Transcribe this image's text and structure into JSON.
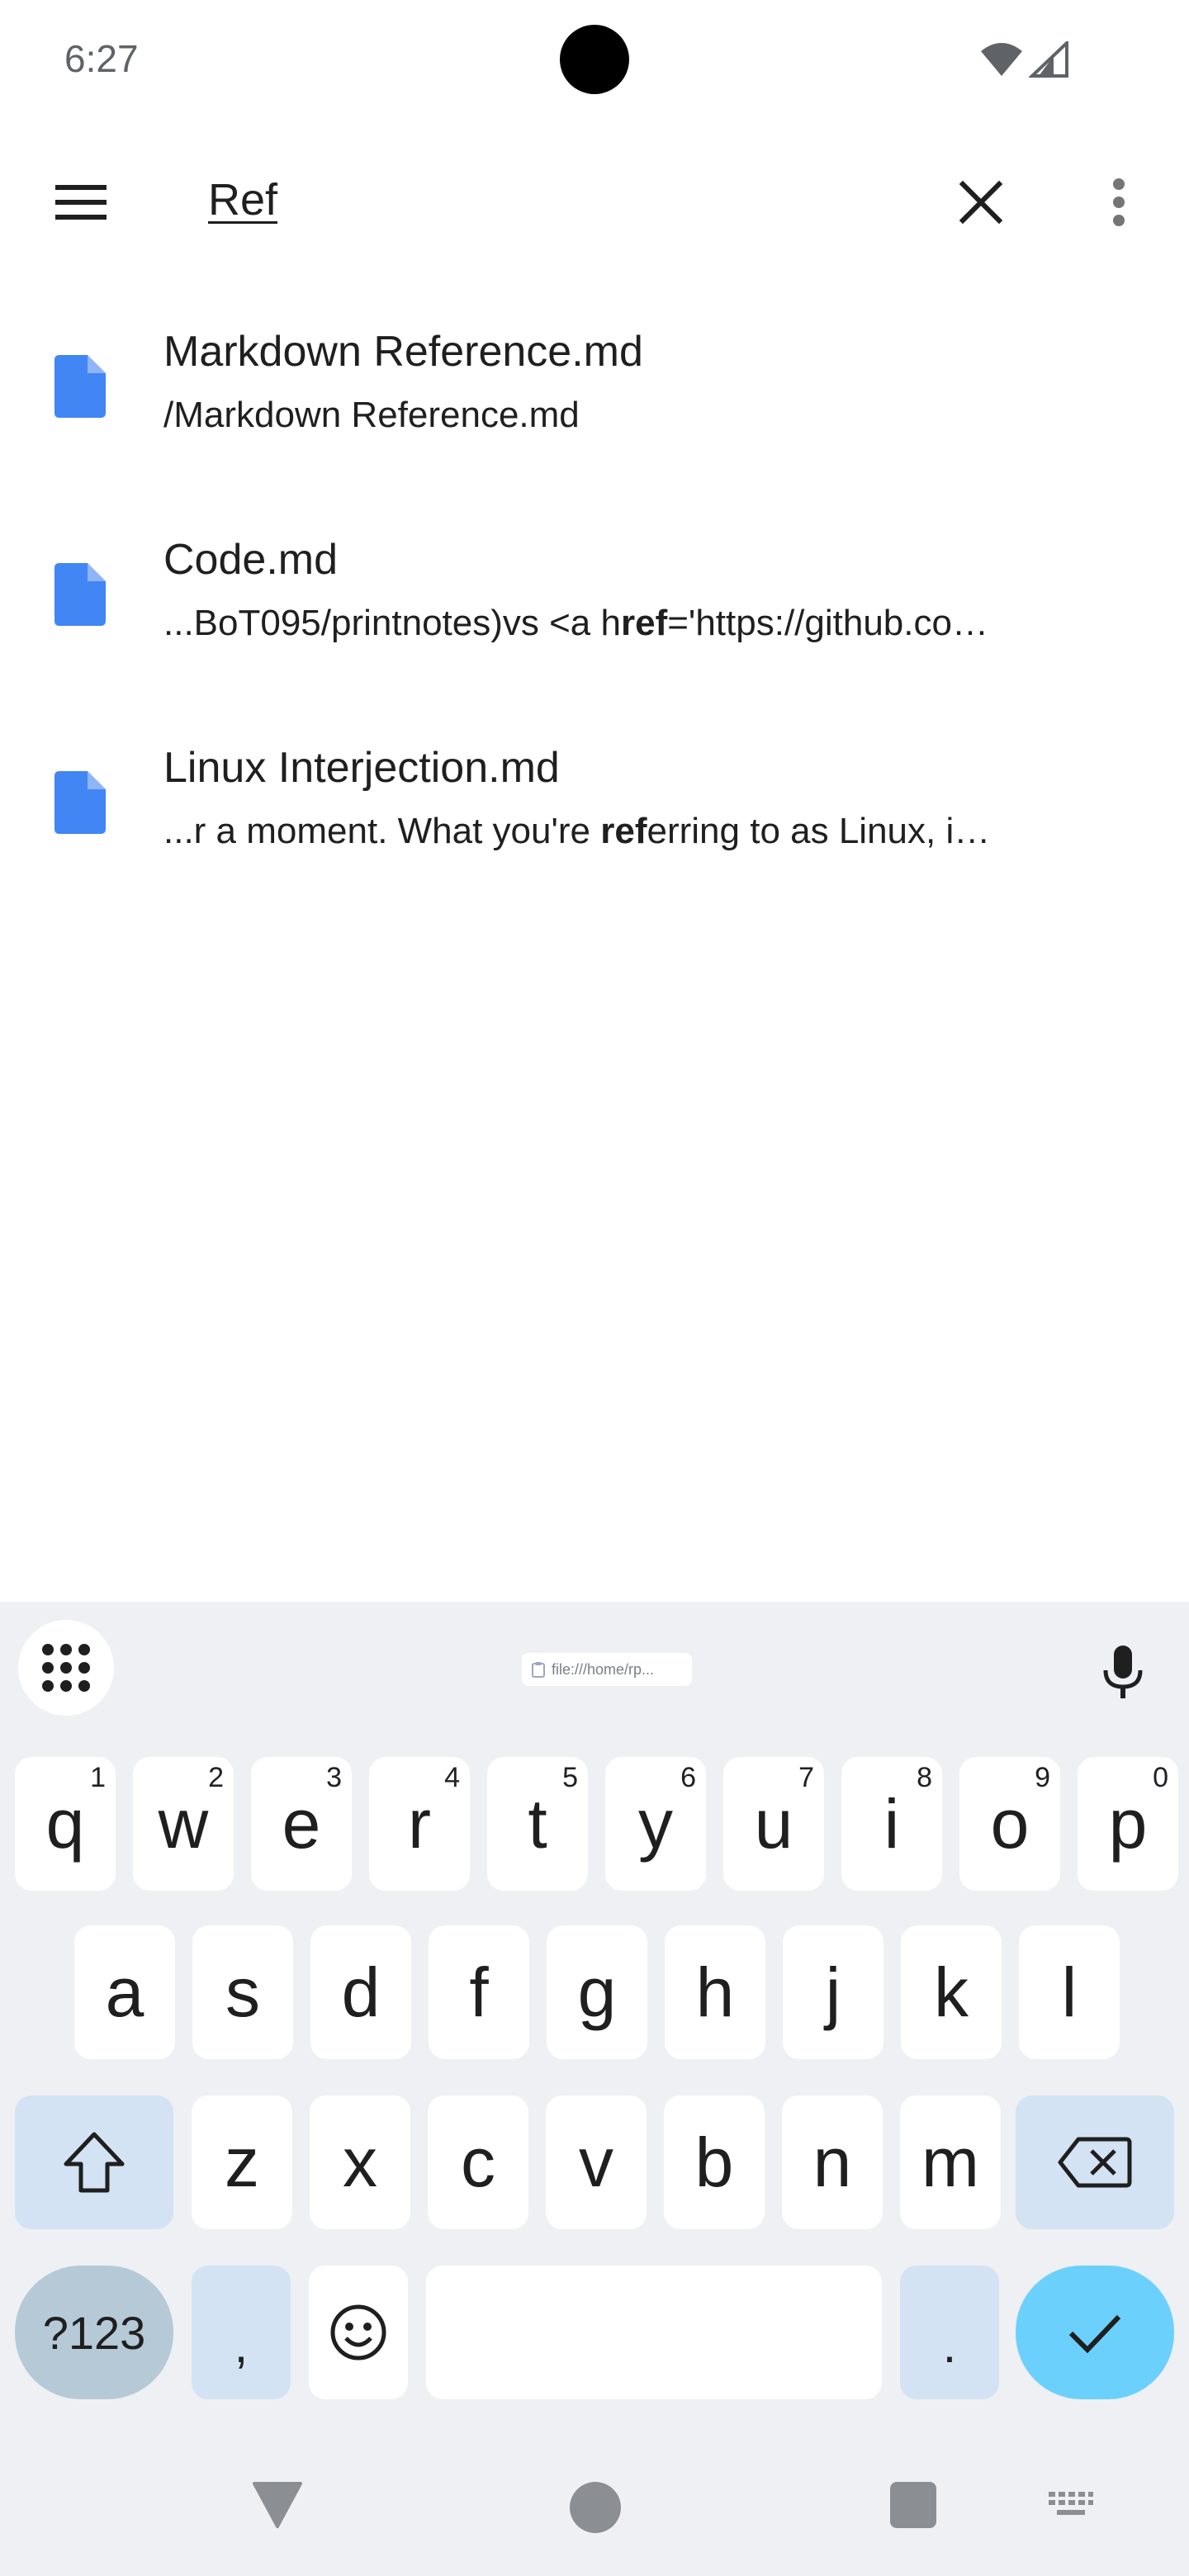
{
  "status_bar": {
    "time": "6:27",
    "icons": [
      "wifi-icon",
      "signal-icon"
    ]
  },
  "app_bar": {
    "menu_icon": "hamburger-menu-icon",
    "search_value": "Ref",
    "clear_icon": "close-icon",
    "more_icon": "more-vert-icon"
  },
  "results": [
    {
      "icon": "file-icon",
      "title": "Markdown Reference.md",
      "snippet_before": "/Markdown Reference.md",
      "snippet_match": "",
      "snippet_after": ""
    },
    {
      "icon": "file-icon",
      "title": "Code.md",
      "snippet_before": "...BoT095/printnotes)vs <a h",
      "snippet_match": "ref",
      "snippet_after": "='https://github.co…"
    },
    {
      "icon": "file-icon",
      "title": "Linux Interjection.md",
      "snippet_before": "...r a moment.  What you're ",
      "snippet_match": "ref",
      "snippet_after": "erring to as Linux, i…"
    }
  ],
  "keyboard": {
    "clipboard_chip": "file:///home/rp...",
    "row1": [
      {
        "k": "q",
        "h": "1"
      },
      {
        "k": "w",
        "h": "2"
      },
      {
        "k": "e",
        "h": "3"
      },
      {
        "k": "r",
        "h": "4"
      },
      {
        "k": "t",
        "h": "5"
      },
      {
        "k": "y",
        "h": "6"
      },
      {
        "k": "u",
        "h": "7"
      },
      {
        "k": "i",
        "h": "8"
      },
      {
        "k": "o",
        "h": "9"
      },
      {
        "k": "p",
        "h": "0"
      }
    ],
    "row2": [
      "a",
      "s",
      "d",
      "f",
      "g",
      "h",
      "j",
      "k",
      "l"
    ],
    "row3": [
      "z",
      "x",
      "c",
      "v",
      "b",
      "n",
      "m"
    ],
    "symbols_label": "?123",
    "comma_label": ",",
    "period_label": "."
  },
  "colors": {
    "file_icon": "#4285f4",
    "keyboard_bg": "#eef0f4",
    "modifier_key": "#d3e3f3",
    "enter_key": "#6cd0fc",
    "symbols_key": "#b6c9d6"
  }
}
